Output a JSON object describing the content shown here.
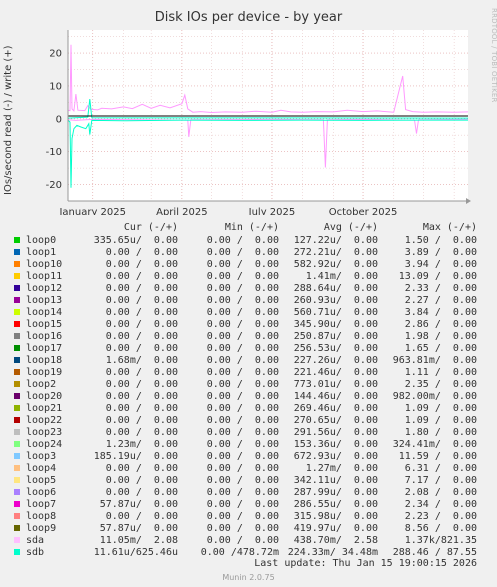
{
  "chart_data": {
    "type": "line",
    "title": "Disk IOs per device - by year",
    "ylabel": "IOs/second read (-) / write (+)",
    "ylim": [
      -25,
      27
    ],
    "yticks": [
      20,
      10,
      0,
      -10,
      -20
    ],
    "xlim": [
      "2024-12-07",
      "2026-01-15"
    ],
    "xticks": [
      {
        "date": "2025-01-01",
        "label": "January 2025"
      },
      {
        "date": "2025-04-01",
        "label": "April 2025"
      },
      {
        "date": "2025-07-01",
        "label": "July 2025"
      },
      {
        "date": "2025-10-01",
        "label": "October 2025"
      }
    ],
    "series": [
      {
        "name": "sda",
        "color": "#ff99ff",
        "direction": "write",
        "points": [
          [
            "2024-12-07",
            2.6
          ],
          [
            "2024-12-09",
            2.5
          ],
          [
            "2024-12-10",
            22.5
          ],
          [
            "2024-12-11",
            3.0
          ],
          [
            "2024-12-13",
            2.4
          ],
          [
            "2024-12-15",
            7.5
          ],
          [
            "2024-12-17",
            2.6
          ],
          [
            "2024-12-24",
            2.5
          ],
          [
            "2024-12-27",
            4.0
          ],
          [
            "2024-12-30",
            2.9
          ],
          [
            "2025-01-06",
            2.7
          ],
          [
            "2025-01-10",
            3.2
          ],
          [
            "2025-01-20",
            3.0
          ],
          [
            "2025-02-01",
            3.6
          ],
          [
            "2025-02-10",
            3.1
          ],
          [
            "2025-02-20",
            4.4
          ],
          [
            "2025-03-01",
            3.2
          ],
          [
            "2025-03-10",
            4.1
          ],
          [
            "2025-03-20",
            3.3
          ],
          [
            "2025-04-01",
            4.6
          ],
          [
            "2025-04-04",
            7.2
          ],
          [
            "2025-04-07",
            3.0
          ],
          [
            "2025-04-12",
            2.0
          ],
          [
            "2025-04-20",
            2.2
          ],
          [
            "2025-05-01",
            1.9
          ],
          [
            "2025-05-15",
            2.1
          ],
          [
            "2025-06-01",
            2.0
          ],
          [
            "2025-06-15",
            2.3
          ],
          [
            "2025-07-01",
            2.0
          ],
          [
            "2025-07-10",
            2.6
          ],
          [
            "2025-07-20",
            2.1
          ],
          [
            "2025-08-01",
            2.0
          ],
          [
            "2025-08-15",
            2.2
          ],
          [
            "2025-09-01",
            2.1
          ],
          [
            "2025-09-15",
            2.6
          ],
          [
            "2025-10-01",
            2.2
          ],
          [
            "2025-10-15",
            2.4
          ],
          [
            "2025-11-01",
            2.0
          ],
          [
            "2025-11-10",
            13.0
          ],
          [
            "2025-11-13",
            2.8
          ],
          [
            "2025-11-20",
            2.2
          ],
          [
            "2025-12-01",
            2.0
          ],
          [
            "2025-12-15",
            2.1
          ],
          [
            "2026-01-01",
            2.0
          ],
          [
            "2026-01-15",
            2.1
          ]
        ]
      },
      {
        "name": "sda",
        "color": "#ff99ff",
        "direction": "read",
        "points": [
          [
            "2024-12-07",
            -0.3
          ],
          [
            "2024-12-15",
            -0.5
          ],
          [
            "2025-01-01",
            -0.2
          ],
          [
            "2025-04-07",
            -0.4
          ],
          [
            "2025-04-08",
            -5.5
          ],
          [
            "2025-04-10",
            -0.3
          ],
          [
            "2025-07-01",
            -0.2
          ],
          [
            "2025-08-22",
            -0.3
          ],
          [
            "2025-08-24",
            -14.8
          ],
          [
            "2025-08-26",
            -0.3
          ],
          [
            "2025-10-01",
            -0.2
          ],
          [
            "2025-11-22",
            -0.4
          ],
          [
            "2025-11-24",
            -4.5
          ],
          [
            "2025-11-26",
            -0.3
          ],
          [
            "2026-01-15",
            -0.2
          ]
        ]
      },
      {
        "name": "sdb",
        "color": "#00ffcc",
        "direction": "read",
        "points": [
          [
            "2024-12-07",
            -0.4
          ],
          [
            "2024-12-09",
            -1.0
          ],
          [
            "2024-12-10",
            -21.0
          ],
          [
            "2024-12-11",
            -6.0
          ],
          [
            "2024-12-13",
            -3.0
          ],
          [
            "2024-12-16",
            -2.0
          ],
          [
            "2024-12-20",
            -2.5
          ],
          [
            "2024-12-25",
            -3.0
          ],
          [
            "2024-12-28",
            -1.5
          ],
          [
            "2024-12-29",
            -4.8
          ],
          [
            "2024-12-31",
            -0.5
          ],
          [
            "2025-02-01",
            -0.6
          ],
          [
            "2025-04-01",
            -0.4
          ],
          [
            "2025-06-01",
            -0.5
          ],
          [
            "2025-08-01",
            -0.4
          ],
          [
            "2025-10-01",
            -0.5
          ],
          [
            "2025-12-01",
            -0.4
          ],
          [
            "2026-01-15",
            -0.4
          ]
        ]
      },
      {
        "name": "sdb",
        "color": "#00ffcc",
        "direction": "write",
        "points": [
          [
            "2024-12-07",
            0.2
          ],
          [
            "2024-12-27",
            0.5
          ],
          [
            "2024-12-29",
            6.0
          ],
          [
            "2024-12-31",
            0.3
          ],
          [
            "2026-01-15",
            0.2
          ]
        ]
      }
    ]
  },
  "side_label": "RRDTOOL / TOBI OETIKER",
  "legend_header": {
    "cur": "Cur (-/+)",
    "min": "Min (-/+)",
    "avg": "Avg (-/+)",
    "max": "Max (-/+)"
  },
  "legend": [
    {
      "name": "loop0",
      "color": "#00cc00",
      "cur": "335.65u/  0.00",
      "min": "0.00 /  0.00",
      "avg": "127.22u/  0.00",
      "max": "1.50 /  0.00"
    },
    {
      "name": "loop1",
      "color": "#0066b3",
      "cur": "0.00 /  0.00",
      "min": "0.00 /  0.00",
      "avg": "272.21u/  0.00",
      "max": "3.89 /  0.00"
    },
    {
      "name": "loop10",
      "color": "#ff8000",
      "cur": "0.00 /  0.00",
      "min": "0.00 /  0.00",
      "avg": "582.92u/  0.00",
      "max": "3.94 /  0.00"
    },
    {
      "name": "loop11",
      "color": "#ffcc00",
      "cur": "0.00 /  0.00",
      "min": "0.00 /  0.00",
      "avg": "1.41m/  0.00",
      "max": "13.09 /  0.00"
    },
    {
      "name": "loop12",
      "color": "#330099",
      "cur": "0.00 /  0.00",
      "min": "0.00 /  0.00",
      "avg": "288.64u/  0.00",
      "max": "2.33 /  0.00"
    },
    {
      "name": "loop13",
      "color": "#990099",
      "cur": "0.00 /  0.00",
      "min": "0.00 /  0.00",
      "avg": "260.93u/  0.00",
      "max": "2.27 /  0.00"
    },
    {
      "name": "loop14",
      "color": "#ccff00",
      "cur": "0.00 /  0.00",
      "min": "0.00 /  0.00",
      "avg": "560.71u/  0.00",
      "max": "3.84 /  0.00"
    },
    {
      "name": "loop15",
      "color": "#ff0000",
      "cur": "0.00 /  0.00",
      "min": "0.00 /  0.00",
      "avg": "345.90u/  0.00",
      "max": "2.86 /  0.00"
    },
    {
      "name": "loop16",
      "color": "#808080",
      "cur": "0.00 /  0.00",
      "min": "0.00 /  0.00",
      "avg": "250.87u/  0.00",
      "max": "1.98 /  0.00"
    },
    {
      "name": "loop17",
      "color": "#008f00",
      "cur": "0.00 /  0.00",
      "min": "0.00 /  0.00",
      "avg": "256.53u/  0.00",
      "max": "1.65 /  0.00"
    },
    {
      "name": "loop18",
      "color": "#00487d",
      "cur": "1.68m/  0.00",
      "min": "0.00 /  0.00",
      "avg": "227.26u/  0.00",
      "max": "963.81m/  0.00"
    },
    {
      "name": "loop19",
      "color": "#b35a00",
      "cur": "0.00 /  0.00",
      "min": "0.00 /  0.00",
      "avg": "221.46u/  0.00",
      "max": "1.11 /  0.00"
    },
    {
      "name": "loop2",
      "color": "#b38f00",
      "cur": "0.00 /  0.00",
      "min": "0.00 /  0.00",
      "avg": "773.01u/  0.00",
      "max": "2.35 /  0.00"
    },
    {
      "name": "loop20",
      "color": "#6b006b",
      "cur": "0.00 /  0.00",
      "min": "0.00 /  0.00",
      "avg": "144.46u/  0.00",
      "max": "982.00m/  0.00"
    },
    {
      "name": "loop21",
      "color": "#8fb300",
      "cur": "0.00 /  0.00",
      "min": "0.00 /  0.00",
      "avg": "269.46u/  0.00",
      "max": "1.09 /  0.00"
    },
    {
      "name": "loop22",
      "color": "#b30000",
      "cur": "0.00 /  0.00",
      "min": "0.00 /  0.00",
      "avg": "270.65u/  0.00",
      "max": "1.09 /  0.00"
    },
    {
      "name": "loop23",
      "color": "#bebebe",
      "cur": "0.00 /  0.00",
      "min": "0.00 /  0.00",
      "avg": "291.56u/  0.00",
      "max": "1.80 /  0.00"
    },
    {
      "name": "loop24",
      "color": "#80ff80",
      "cur": "1.23m/  0.00",
      "min": "0.00 /  0.00",
      "avg": "153.36u/  0.00",
      "max": "324.41m/  0.00"
    },
    {
      "name": "loop3",
      "color": "#80c9ff",
      "cur": "185.19u/  0.00",
      "min": "0.00 /  0.00",
      "avg": "672.93u/  0.00",
      "max": "11.59 /  0.00"
    },
    {
      "name": "loop4",
      "color": "#ffc080",
      "cur": "0.00 /  0.00",
      "min": "0.00 /  0.00",
      "avg": "1.27m/  0.00",
      "max": "6.31 /  0.00"
    },
    {
      "name": "loop5",
      "color": "#ffe680",
      "cur": "0.00 /  0.00",
      "min": "0.00 /  0.00",
      "avg": "342.11u/  0.00",
      "max": "7.17 /  0.00"
    },
    {
      "name": "loop6",
      "color": "#aa80ff",
      "cur": "0.00 /  0.00",
      "min": "0.00 /  0.00",
      "avg": "287.99u/  0.00",
      "max": "2.08 /  0.00"
    },
    {
      "name": "loop7",
      "color": "#ee00cc",
      "cur": "57.87u/  0.00",
      "min": "0.00 /  0.00",
      "avg": "286.55u/  0.00",
      "max": "2.34 /  0.00"
    },
    {
      "name": "loop8",
      "color": "#ff8080",
      "cur": "0.00 /  0.00",
      "min": "0.00 /  0.00",
      "avg": "315.98u/  0.00",
      "max": "2.23 /  0.00"
    },
    {
      "name": "loop9",
      "color": "#666600",
      "cur": "57.87u/  0.00",
      "min": "0.00 /  0.00",
      "avg": "419.97u/  0.00",
      "max": "8.56 /  0.00"
    },
    {
      "name": "sda",
      "color": "#ffbfff",
      "cur": "11.05m/  2.08",
      "min": "0.00 /  0.00",
      "avg": "438.70m/  2.58",
      "max": "1.37k/821.35"
    },
    {
      "name": "sdb",
      "color": "#00ffcc",
      "cur": "11.61u/625.46u",
      "min": "0.00 /478.72m",
      "avg": "224.33m/ 34.48m",
      "max": "288.46 / 87.55"
    }
  ],
  "last_update": "Last update: Thu Jan 15 19:00:15 2026",
  "munin_version": "Munin 2.0.75"
}
